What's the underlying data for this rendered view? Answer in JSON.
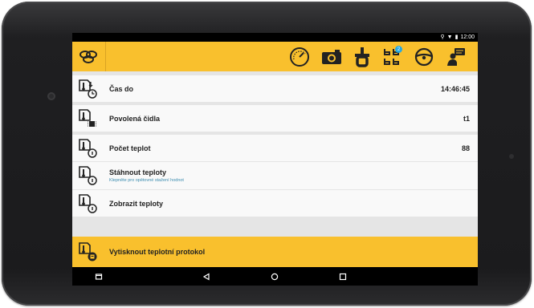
{
  "status_bar": {
    "time": "12:00",
    "icons": [
      "location-icon",
      "wifi-icon",
      "battery-icon"
    ]
  },
  "toolbar": {
    "background": "#f9c02d",
    "logo_icon": "brand-logo-icon",
    "icons": [
      "speedometer-icon",
      "camera-icon",
      "tachograph-icon",
      "vehicles-icon",
      "steering-wheel-icon",
      "driver-message-icon"
    ],
    "vehicles_badge": "2"
  },
  "settings": [
    {
      "label": "Čas do",
      "value": "14:46:45",
      "icon": "thermometer-clock-icon"
    },
    {
      "label": "Povolená čidla",
      "value": "t1",
      "icon": "thermometer-chip-icon"
    },
    {
      "label": "Počet teplot",
      "value": "88",
      "icon": "thermometer-info-icon"
    },
    {
      "label": "Stáhnout teploty",
      "subtitle": "Klepněte pro opětovné stažení hodnot",
      "icon": "thermometer-info-icon"
    },
    {
      "label": "Zobrazit teploty",
      "icon": "thermometer-info-icon"
    },
    {
      "label": "Vytisknout teplotní protokol",
      "icon": "thermometer-print-icon",
      "highlighted": true
    }
  ],
  "nav_bar": [
    "recents-icon",
    "back-icon",
    "home-icon",
    "overview-icon"
  ]
}
